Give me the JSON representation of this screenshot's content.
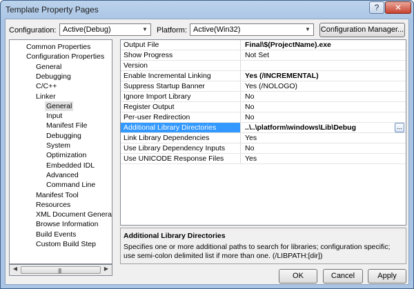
{
  "window": {
    "title": "Template Property Pages",
    "help_glyph": "?",
    "close_glyph": "✕"
  },
  "toolbar": {
    "configuration_label": "Configuration:",
    "configuration_value": "Active(Debug)",
    "platform_label": "Platform:",
    "platform_value": "Active(Win32)",
    "config_manager_label": "Configuration Manager..."
  },
  "tree": {
    "items": [
      {
        "label": "Common Properties",
        "level": 0
      },
      {
        "label": "Configuration Properties",
        "level": 0
      },
      {
        "label": "General",
        "level": 1
      },
      {
        "label": "Debugging",
        "level": 1
      },
      {
        "label": "C/C++",
        "level": 1
      },
      {
        "label": "Linker",
        "level": 1
      },
      {
        "label": "General",
        "level": 2,
        "selected": true
      },
      {
        "label": "Input",
        "level": 2
      },
      {
        "label": "Manifest File",
        "level": 2
      },
      {
        "label": "Debugging",
        "level": 2
      },
      {
        "label": "System",
        "level": 2
      },
      {
        "label": "Optimization",
        "level": 2
      },
      {
        "label": "Embedded IDL",
        "level": 2
      },
      {
        "label": "Advanced",
        "level": 2
      },
      {
        "label": "Command Line",
        "level": 2
      },
      {
        "label": "Manifest Tool",
        "level": 1
      },
      {
        "label": "Resources",
        "level": 1
      },
      {
        "label": "XML Document Generator",
        "level": 1
      },
      {
        "label": "Browse Information",
        "level": 1
      },
      {
        "label": "Build Events",
        "level": 1
      },
      {
        "label": "Custom Build Step",
        "level": 1
      }
    ]
  },
  "properties": {
    "rows": [
      {
        "name": "Output File",
        "value": "Final\\$(ProjectName).exe",
        "bold": true
      },
      {
        "name": "Show Progress",
        "value": "Not Set"
      },
      {
        "name": "Version",
        "value": ""
      },
      {
        "name": "Enable Incremental Linking",
        "value": "Yes (/INCREMENTAL)",
        "bold": true
      },
      {
        "name": "Suppress Startup Banner",
        "value": "Yes (/NOLOGO)"
      },
      {
        "name": "Ignore Import Library",
        "value": "No"
      },
      {
        "name": "Register Output",
        "value": "No"
      },
      {
        "name": "Per-user Redirection",
        "value": "No"
      },
      {
        "name": "Additional Library Directories",
        "value": "..\\..\\platform\\windows\\Lib\\Debug",
        "bold": true,
        "selected": true
      },
      {
        "name": "Link Library Dependencies",
        "value": "Yes"
      },
      {
        "name": "Use Library Dependency Inputs",
        "value": "No"
      },
      {
        "name": "Use UNICODE Response Files",
        "value": "Yes"
      }
    ],
    "ellipsis_label": "..."
  },
  "description": {
    "title": "Additional Library Directories",
    "text": "Specifies one or more additional paths to search for libraries; configuration specific; use semi-colon delimited list if more than one.     (/LIBPATH:[dir])"
  },
  "footer": {
    "ok_label": "OK",
    "cancel_label": "Cancel",
    "apply_label": "Apply"
  },
  "scrollbar": {
    "left_arrow": "◀",
    "right_arrow": "▶",
    "grip": "||||"
  }
}
